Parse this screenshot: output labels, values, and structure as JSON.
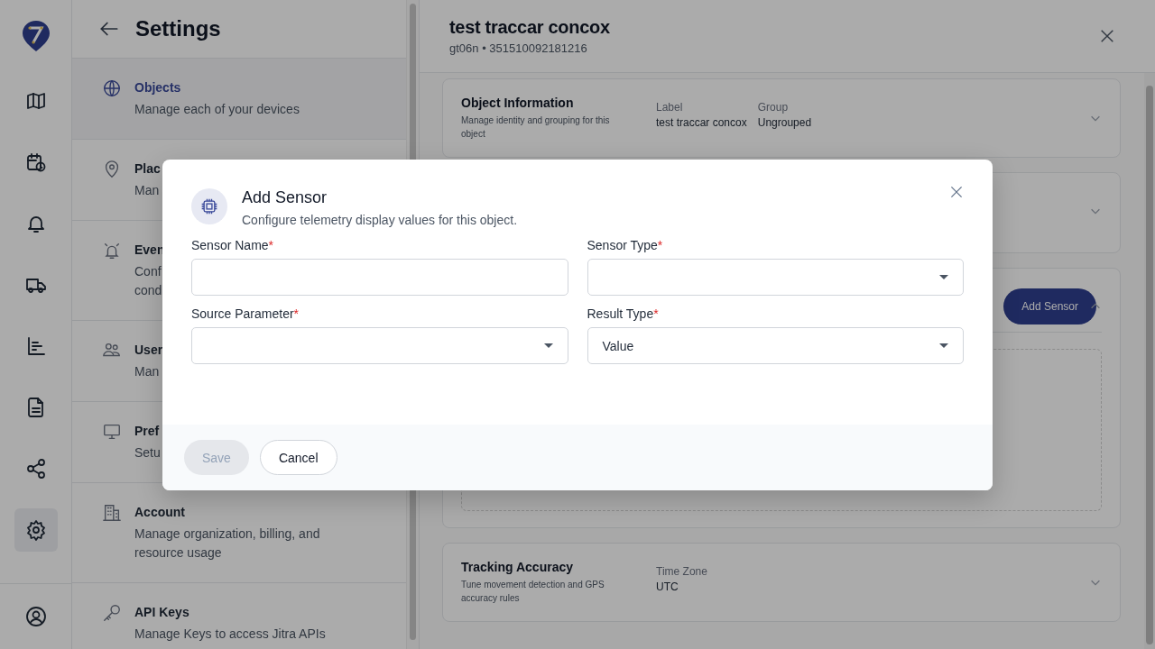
{
  "rail": {
    "items": [
      {
        "selected": false
      },
      {
        "selected": false
      },
      {
        "selected": false
      },
      {
        "selected": false
      },
      {
        "selected": false
      },
      {
        "selected": false
      },
      {
        "selected": false
      },
      {
        "selected": true
      }
    ]
  },
  "settings": {
    "title": "Settings",
    "items": [
      {
        "title": "Objects",
        "description": "Manage each of your devices",
        "selected": true
      },
      {
        "title": "Plac",
        "description": "Man",
        "selected": false
      },
      {
        "title": "Even",
        "description": "Conf\ncond",
        "selected": false
      },
      {
        "title": "User",
        "description": "Man",
        "selected": false
      },
      {
        "title": "Pref",
        "description": "Setu",
        "selected": false
      },
      {
        "title": "Account",
        "description": "Manage organization, billing, and resource usage",
        "selected": false
      },
      {
        "title": "API Keys",
        "description": "Manage Keys to access Jitra APIs",
        "selected": false
      }
    ]
  },
  "object": {
    "title": "test traccar concox",
    "subtitle": "gt06n • 351510092181216",
    "cards": [
      {
        "title": "Object Information",
        "description": "Manage identity and grouping for this object",
        "fields": [
          {
            "label": "Label",
            "value": "test traccar concox"
          },
          {
            "label": "Group",
            "value": "Ungrouped"
          }
        ],
        "expanded": false
      },
      {
        "expanded": false
      },
      {
        "action": "Add Sensor",
        "expanded": true
      },
      {
        "title": "Tracking Accuracy",
        "description": "Tune movement detection and GPS accuracy rules",
        "fields": [
          {
            "label": "Time Zone",
            "value": "UTC"
          }
        ],
        "expanded": false
      }
    ]
  },
  "dialog": {
    "title": "Add Sensor",
    "subtitle": "Configure telemetry display values for this object.",
    "fields": [
      {
        "label": "Sensor Name",
        "required_mark": "*",
        "kind": "text"
      },
      {
        "label": "Sensor Type",
        "required_mark": "*",
        "kind": "select"
      },
      {
        "label": "Source Parameter",
        "required_mark": "*",
        "kind": "select"
      },
      {
        "label": "Result Type",
        "required_mark": "*",
        "kind": "select",
        "value": "Value"
      }
    ],
    "buttons": [
      {
        "label": "Save",
        "kind": "primary",
        "disabled": true
      },
      {
        "label": "Cancel",
        "kind": "secondary",
        "disabled": false
      }
    ]
  }
}
